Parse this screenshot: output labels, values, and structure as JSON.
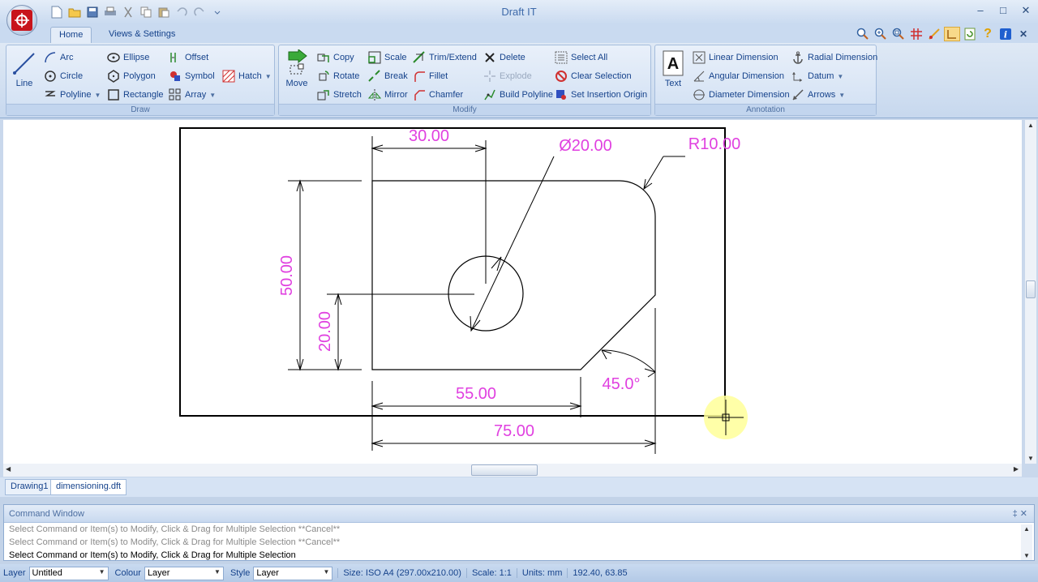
{
  "window": {
    "title": "Draft IT",
    "controls": [
      "–",
      "□",
      "✕"
    ],
    "close_tab": "✕"
  },
  "ribbon_tabs": [
    {
      "label": "Home",
      "active": true
    },
    {
      "label": "Views & Settings",
      "active": false
    }
  ],
  "draw_group": {
    "label": "Draw",
    "line": "Line",
    "arc": "Arc",
    "circle": "Circle",
    "polyline": "Polyline",
    "ellipse": "Ellipse",
    "polygon": "Polygon",
    "rectangle": "Rectangle",
    "offset": "Offset",
    "symbol": "Symbol",
    "array": "Array",
    "hatch": "Hatch"
  },
  "modify_group": {
    "label": "Modify",
    "move": "Move",
    "copy": "Copy",
    "rotate": "Rotate",
    "stretch": "Stretch",
    "scale": "Scale",
    "break": "Break",
    "mirror": "Mirror",
    "trim_extend": "Trim/Extend",
    "fillet": "Fillet",
    "chamfer": "Chamfer",
    "delete": "Delete",
    "explode": "Explode",
    "build_polyline": "Build Polyline",
    "select_all": "Select All",
    "clear_selection": "Clear Selection",
    "set_insertion_origin": "Set Insertion Origin"
  },
  "annotation_group": {
    "label": "Annotation",
    "text": "Text",
    "linear_dimension": "Linear Dimension",
    "angular_dimension": "Angular Dimension",
    "diameter_dimension": "Diameter Dimension",
    "radial_dimension": "Radial Dimension",
    "datum": "Datum",
    "arrows": "Arrows"
  },
  "drawing": {
    "dims": {
      "d30": "30.00",
      "diam": "Ø20.00",
      "radius": "R10.00",
      "d50": "50.00",
      "d20": "20.00",
      "d55": "55.00",
      "angle": "45.0°",
      "d75": "75.00"
    },
    "colors": {
      "dimension_text": "#e040e0",
      "geometry": "#000000",
      "cursor_highlight": "#ffff99"
    }
  },
  "document_tabs": [
    {
      "label": "Drawing1",
      "active": false
    },
    {
      "label": "dimensioning.dft",
      "active": true
    }
  ],
  "command_window": {
    "title": "Command Window",
    "header_controls": "‡   ✕",
    "lines": [
      "Select Command or Item(s) to Modify, Click & Drag for Multiple Selection  **Cancel**",
      "Select Command or Item(s) to Modify, Click & Drag for Multiple Selection  **Cancel**",
      "Select Command or Item(s) to Modify, Click & Drag for Multiple Selection"
    ]
  },
  "status_bar": {
    "layer_label": "Layer",
    "layer_value": "Untitled",
    "colour_label": "Colour",
    "colour_value": "Layer",
    "style_label": "Style",
    "style_value": "Layer",
    "size": "Size: ISO A4 (297.00x210.00)",
    "scale": "Scale: 1:1",
    "units": "Units: mm",
    "coords": "192.40, 63.85"
  }
}
